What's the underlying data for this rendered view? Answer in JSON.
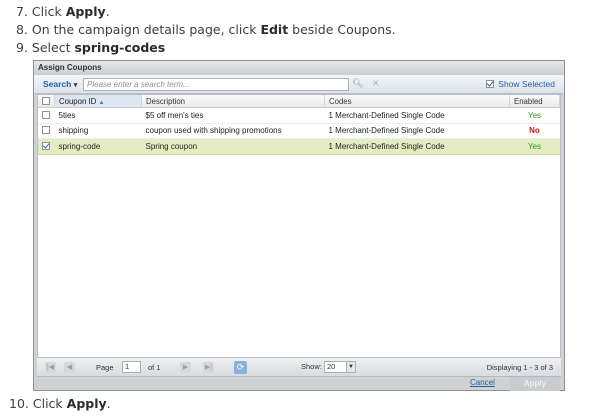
{
  "steps": [
    {
      "num": "7.",
      "pre": "Click ",
      "bold": "Apply",
      "post": "."
    },
    {
      "num": "8.",
      "pre": "On the campaign details page, click ",
      "bold": "Edit",
      "post": " beside Coupons."
    },
    {
      "num": "9.",
      "pre": "Select ",
      "bold": "spring-codes",
      "post": ""
    },
    {
      "num": "10.",
      "pre": "Click ",
      "bold": "Apply",
      "post": "."
    }
  ],
  "dialog": {
    "title": "Assign Coupons",
    "search_label": "Search",
    "search_caret": "▾",
    "search_placeholder": "Please enter a search term...",
    "show_selected_label": "Show Selected",
    "show_selected_checked": true
  },
  "table": {
    "columns": [
      "Coupon ID",
      "Description",
      "Codes",
      "Enabled"
    ],
    "sort_indicator": "▲",
    "rows": [
      {
        "checked": false,
        "id": "5ties",
        "description": "$5 off men's ties",
        "codes": "1 Merchant-Defined Single Code",
        "enabled": "Yes",
        "selected": false
      },
      {
        "checked": false,
        "id": "shipping",
        "description": "coupon used with shipping promotions",
        "codes": "1 Merchant-Defined Single Code",
        "enabled": "No",
        "selected": false
      },
      {
        "checked": true,
        "id": "spring-code",
        "description": "Spring coupon",
        "codes": "1 Merchant-Defined Single Code",
        "enabled": "Yes",
        "selected": true
      }
    ]
  },
  "pager": {
    "page_label": "Page",
    "page_value": "1",
    "of_label": "of 1",
    "show_label": "Show:",
    "show_value": "20",
    "displaying": "Displaying 1 - 3 of 3"
  },
  "buttons": {
    "cancel": "Cancel",
    "apply": "Apply"
  },
  "colors": {
    "selected_row": "#e3edc2",
    "yes": "#2e9a1c",
    "no": "#c11b17",
    "link": "#1f5fa5"
  }
}
